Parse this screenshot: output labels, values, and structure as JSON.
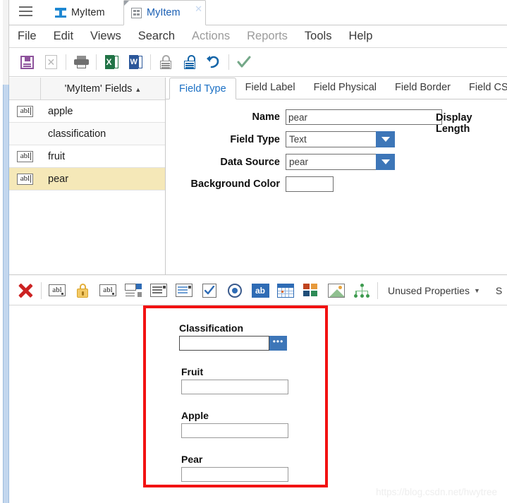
{
  "window": {
    "hamburger_icon": "hamburger-menu-icon",
    "tabs": [
      {
        "label": "MyItem",
        "icon": "ibeam-logo-icon",
        "active": false,
        "closable": false
      },
      {
        "label": "MyItem",
        "icon": "grid-document-icon",
        "active": true,
        "closable": true,
        "close_label": "✕"
      }
    ]
  },
  "menubar": {
    "items": [
      {
        "label": "File",
        "dim": false
      },
      {
        "label": "Edit",
        "dim": false
      },
      {
        "label": "Views",
        "dim": false
      },
      {
        "label": "Search",
        "dim": false
      },
      {
        "label": "Actions",
        "dim": true
      },
      {
        "label": "Reports",
        "dim": true
      },
      {
        "label": "Tools",
        "dim": false
      },
      {
        "label": "Help",
        "dim": false
      }
    ]
  },
  "toolbar": {
    "buttons": [
      {
        "name": "save-button",
        "icon": "floppy-disk-save-icon"
      },
      {
        "name": "delete-button",
        "icon": "page-delete-x-icon"
      },
      {
        "name": "print-button",
        "icon": "printer-icon"
      },
      {
        "name": "export-excel-button",
        "icon": "excel-export-icon",
        "glyph": "X"
      },
      {
        "name": "export-word-button",
        "icon": "word-export-icon",
        "glyph": "W"
      },
      {
        "name": "lock-button",
        "icon": "lock-closed-icon"
      },
      {
        "name": "unlock-button",
        "icon": "lock-open-icon"
      },
      {
        "name": "undo-button",
        "icon": "undo-arrow-icon"
      },
      {
        "name": "apply-button",
        "icon": "green-checkmark-icon"
      }
    ]
  },
  "fields_panel": {
    "header": {
      "title": "'MyItem' Fields",
      "sort_caret": "▲"
    },
    "rows": [
      {
        "label": "apple",
        "icon": "abl-text-field-icon",
        "icon_text": "abl",
        "has_icon": true,
        "selected": false
      },
      {
        "label": "classification",
        "icon": "",
        "icon_text": "",
        "has_icon": false,
        "selected": false
      },
      {
        "label": "fruit",
        "icon": "abl-text-field-icon",
        "icon_text": "abl",
        "has_icon": true,
        "selected": false
      },
      {
        "label": "pear",
        "icon": "abl-text-field-icon",
        "icon_text": "abl",
        "has_icon": true,
        "selected": true
      }
    ]
  },
  "detail_panel": {
    "tabs": [
      {
        "label": "Field Type",
        "active": true
      },
      {
        "label": "Field Label",
        "active": false
      },
      {
        "label": "Field Physical",
        "active": false
      },
      {
        "label": "Field Border",
        "active": false
      },
      {
        "label": "Field CSS",
        "active": false
      }
    ],
    "form": {
      "name_label": "Name",
      "name_value": "pear",
      "field_type_label": "Field Type",
      "field_type_value": "Text",
      "data_source_label": "Data Source",
      "data_source_value": "pear",
      "background_color_label": "Background Color",
      "background_color_value": "",
      "display_length_label": "Display Length"
    }
  },
  "palette": {
    "buttons": [
      {
        "name": "delete-widget-button",
        "icon": "red-x-icon"
      },
      {
        "name": "text-field-widget-button",
        "icon": "abl-text-field-icon",
        "glyph": "abl"
      },
      {
        "name": "protected-field-widget-button",
        "icon": "yellow-padlock-icon"
      },
      {
        "name": "text-area-widget-button",
        "icon": "abl-textarea-icon",
        "glyph": "abl"
      },
      {
        "name": "combo-widget-button",
        "icon": "combo-box-icon"
      },
      {
        "name": "list-widget-button",
        "icon": "list-lines-icon"
      },
      {
        "name": "multiselect-widget-button",
        "icon": "multi-select-lines-icon"
      },
      {
        "name": "checkbox-widget-button",
        "icon": "checkbox-icon"
      },
      {
        "name": "radio-widget-button",
        "icon": "radio-button-icon"
      },
      {
        "name": "label-widget-button",
        "icon": "ab-label-icon",
        "glyph": "ab"
      },
      {
        "name": "grid-widget-button",
        "icon": "data-grid-icon"
      },
      {
        "name": "tiles-widget-button",
        "icon": "color-tiles-icon"
      },
      {
        "name": "image-widget-button",
        "icon": "image-placeholder-icon"
      },
      {
        "name": "hierarchy-widget-button",
        "icon": "tree-hierarchy-icon"
      }
    ],
    "dropdown_label": "Unused Properties",
    "dropdown_caret": "▼",
    "trailing_label": "S"
  },
  "canvas": {
    "fields": [
      {
        "caption": "Classification",
        "value": "",
        "has_lookup_button": true,
        "lookup_glyph": "•••"
      },
      {
        "caption": "Fruit",
        "value": "",
        "has_lookup_button": false
      },
      {
        "caption": "Apple",
        "value": "",
        "has_lookup_button": false
      },
      {
        "caption": "Pear",
        "value": "",
        "has_lookup_button": false
      }
    ],
    "highlight_color": "#f21212"
  },
  "watermark": "https://blog.csdn.net/hwytree"
}
